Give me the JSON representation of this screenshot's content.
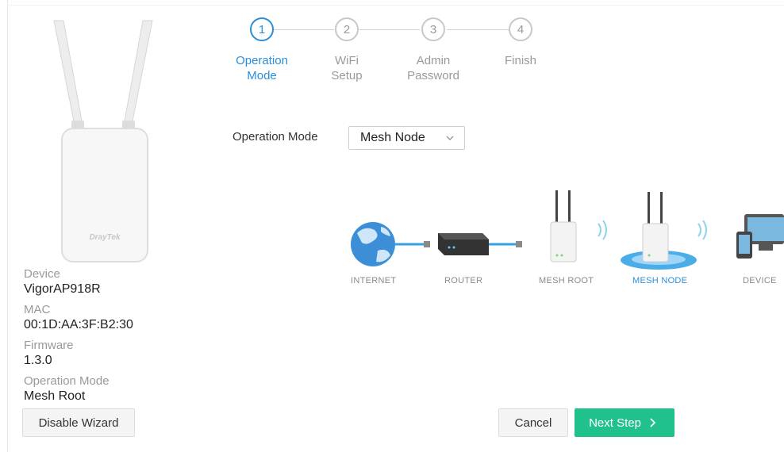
{
  "device_card": {
    "brand_text": "DrayTek",
    "fields": [
      {
        "label": "Device",
        "value": "VigorAP918R"
      },
      {
        "label": "MAC",
        "value": "00:1D:AA:3F:B2:30"
      },
      {
        "label": "Firmware",
        "value": "1.3.0"
      },
      {
        "label": "Operation Mode",
        "value": "Mesh Root"
      }
    ],
    "disable_wizard_label": "Disable Wizard"
  },
  "wizard": {
    "steps": [
      {
        "number": "1",
        "line1": "Operation",
        "line2": "Mode",
        "active": true
      },
      {
        "number": "2",
        "line1": "WiFi",
        "line2": "Setup",
        "active": false
      },
      {
        "number": "3",
        "line1": "Admin",
        "line2": "Password",
        "active": false
      },
      {
        "number": "4",
        "line1": "Finish",
        "line2": "",
        "active": false
      }
    ],
    "active_color": "#2b8fd8"
  },
  "operation_mode": {
    "label": "Operation Mode",
    "selected": "Mesh Node"
  },
  "topology": {
    "items": [
      "INTERNET",
      "ROUTER",
      "MESH ROOT",
      "MESH NODE",
      "DEVICE"
    ],
    "active_item": "MESH NODE",
    "icons": [
      "globe-icon",
      "router-icon",
      "mesh-root-ap-icon",
      "mesh-node-ap-icon",
      "devices-icon"
    ]
  },
  "actions": {
    "cancel_label": "Cancel",
    "next_label": "Next Step",
    "next_color": "#21c18e"
  }
}
